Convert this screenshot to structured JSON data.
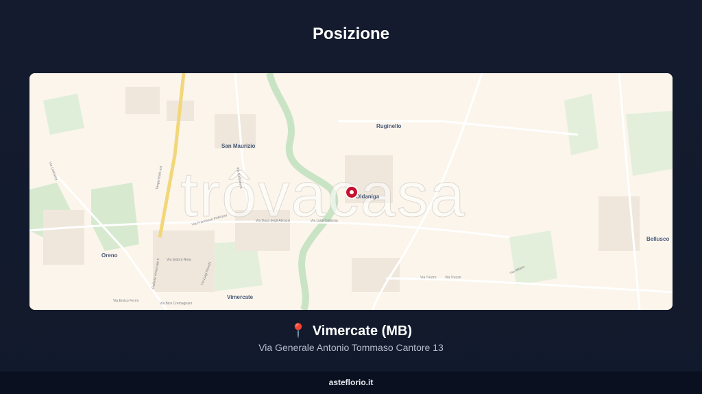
{
  "page": {
    "title": "Posizione"
  },
  "map": {
    "watermark": "trôvacasa",
    "places": {
      "san_maurizio": "San Maurizio",
      "ruginello": "Ruginello",
      "oldaniga": "Oldaniga",
      "oreno": "Oreno",
      "vimercate": "Vimercate",
      "bellusco": "Bellusco"
    },
    "streets": {
      "tangenziale": "Tangenziale est",
      "via_lodovica": "Via Lodovica",
      "via_galbusera": "Via Galbusera",
      "galleria": "Galleria Vimercate II",
      "via_pellizzari": "Via Francesco Pellizzari",
      "via_rota": "Via Isidoro Rota",
      "via_ronchi": "Via Luigi Ronchi",
      "via_enrico_fermi": "Via Enrico Fermi",
      "via_cremagnani": "Via Bice Cremagnani",
      "via_alpini": "Via Duca degli Abruzzi",
      "via_cadorna": "Via Luigi Cadorna",
      "via_milano": "Via Milano",
      "via_trezzo": "Via Trezzo",
      "via_trezzo2": "Via Trezzo"
    },
    "accent": "#c8102e"
  },
  "location": {
    "icon": "map-pin-icon",
    "city": "Vimercate (MB)",
    "address": "Via Generale Antonio Tommaso Cantore 13"
  },
  "footer": {
    "site": "asteflorio.it"
  }
}
